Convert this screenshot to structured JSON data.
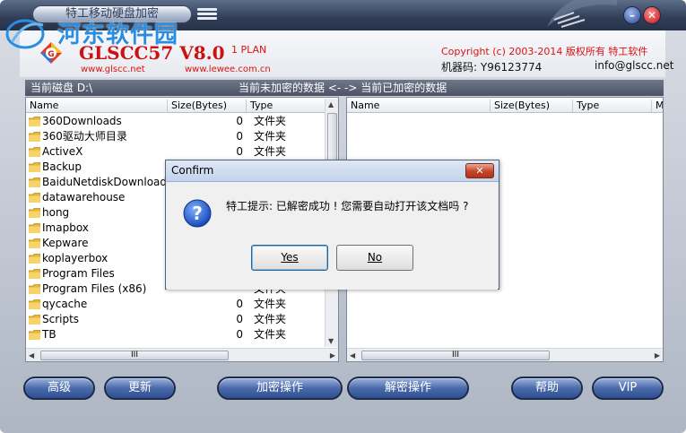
{
  "window": {
    "title": "特工移动硬盘加密",
    "minimize_label": "–",
    "close_label": "✕"
  },
  "watermark": {
    "text": "河东软件园"
  },
  "header": {
    "brand": "GLSCC57 V8.0",
    "plan": "1 PLAN",
    "site1": "www.glscc.net",
    "site2": "www.lewee.com.cn",
    "copyright": "Copyright (c) 2003-2014 版权所有 特工软件",
    "machine_code": "机器码: Y96123774",
    "email": "info@glscc.net"
  },
  "pathbar": {
    "current_disk": "当前磁盘 D:\\",
    "direction": "当前未加密的数据 <- -> 当前已加密的数据"
  },
  "left_pane": {
    "columns": [
      "Name",
      "Size(Bytes)",
      "Type"
    ],
    "rows": [
      {
        "name": "360Downloads",
        "size": "0",
        "type": "文件夹"
      },
      {
        "name": "360驱动大师目录",
        "size": "0",
        "type": "文件夹"
      },
      {
        "name": "ActiveX",
        "size": "0",
        "type": "文件夹"
      },
      {
        "name": "Backup",
        "size": "",
        "type": ""
      },
      {
        "name": "BaiduNetdiskDownload",
        "size": "",
        "type": ""
      },
      {
        "name": "datawarehouse",
        "size": "",
        "type": ""
      },
      {
        "name": "hong",
        "size": "",
        "type": ""
      },
      {
        "name": "Imapbox",
        "size": "",
        "type": ""
      },
      {
        "name": "Kepware",
        "size": "",
        "type": ""
      },
      {
        "name": "koplayerbox",
        "size": "",
        "type": ""
      },
      {
        "name": "Program Files",
        "size": "",
        "type": ""
      },
      {
        "name": "Program Files (x86)",
        "size": "",
        "type": "文件夹"
      },
      {
        "name": "qycache",
        "size": "0",
        "type": "文件夹"
      },
      {
        "name": "Scripts",
        "size": "0",
        "type": "文件夹"
      },
      {
        "name": "TB",
        "size": "0",
        "type": "文件夹"
      }
    ],
    "hscroll_grip": "III"
  },
  "right_pane": {
    "columns": [
      "Name",
      "Size(Bytes)",
      "Type",
      "M"
    ],
    "hscroll_grip": "III"
  },
  "buttons": {
    "advanced": "高级",
    "update": "更新",
    "encrypt": "加密操作",
    "decrypt": "解密操作",
    "help": "帮助",
    "vip": "VIP"
  },
  "dialog": {
    "title": "Confirm",
    "message": "特工提示: 已解密成功 ! 您需要自动打开该文档吗 ?",
    "yes_label": "Yes",
    "no_label": "No",
    "close_label": "✕"
  },
  "colors": {
    "brand_red": "#cc1111",
    "title_bar": "#2f3d55",
    "button_blue": "#4a6aab",
    "watermark_blue": "#2a8de0"
  }
}
